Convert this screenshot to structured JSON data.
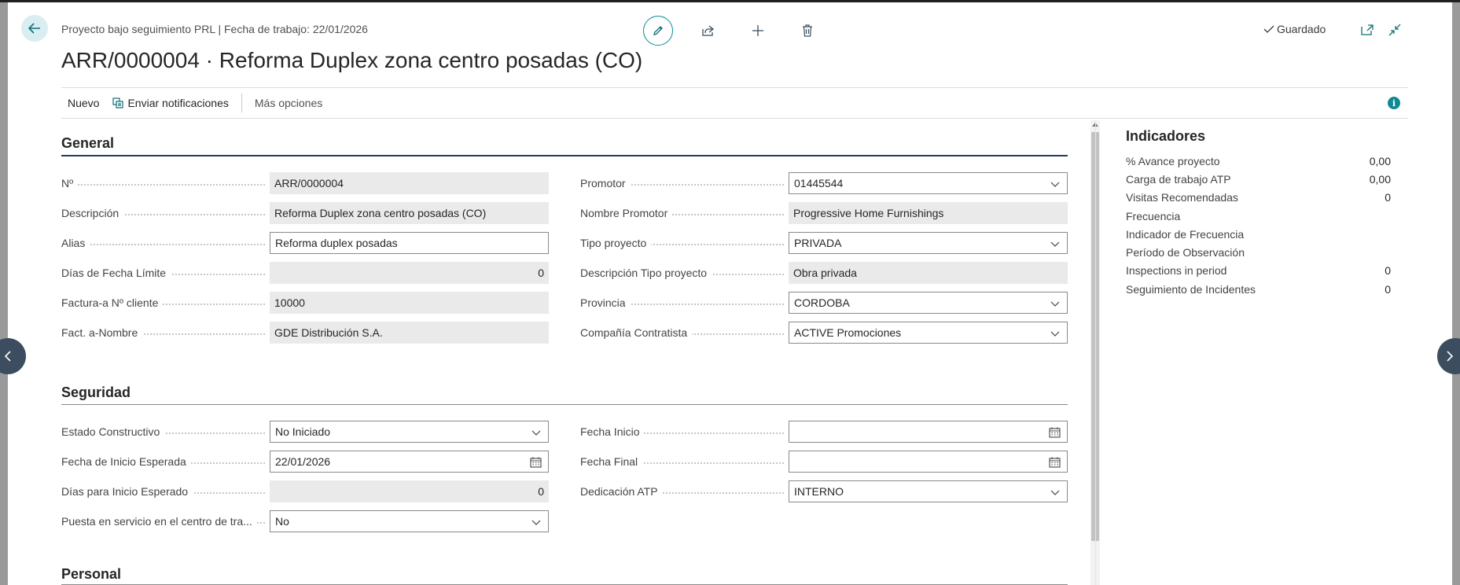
{
  "header": {
    "breadcrumb": "Proyecto bajo seguimiento PRL | Fecha de trabajo: 22/01/2026",
    "title": "ARR/0000004 · Reforma Duplex zona centro posadas (CO)",
    "status": "Guardado",
    "icons": [
      "back-arrow-icon",
      "edit-icon",
      "share-icon",
      "add-icon",
      "delete-icon",
      "check-icon",
      "open-new-window-icon",
      "collapse-icon"
    ]
  },
  "actions": {
    "new": "Nuevo",
    "notify": "Enviar notificaciones",
    "more": "Más opciones",
    "info_glyph": "i"
  },
  "general": {
    "title": "General",
    "left": [
      {
        "label": "Nº",
        "value": "ARR/0000004"
      },
      {
        "label": "Descripción",
        "value": "Reforma Duplex zona centro posadas (CO)"
      },
      {
        "label": "Alias",
        "value": "Reforma duplex posadas"
      },
      {
        "label": "Días de Fecha Límite",
        "value": "0"
      },
      {
        "label": "Factura-a Nº cliente",
        "value": "10000"
      },
      {
        "label": "Fact. a-Nombre",
        "value": "GDE Distribución S.A."
      }
    ],
    "right": [
      {
        "label": "Promotor",
        "value": "01445544"
      },
      {
        "label": "Nombre Promotor",
        "value": "Progressive Home Furnishings"
      },
      {
        "label": "Tipo proyecto",
        "value": "PRIVADA"
      },
      {
        "label": "Descripción Tipo proyecto",
        "value": "Obra privada"
      },
      {
        "label": "Provincia",
        "value": "CORDOBA"
      },
      {
        "label": "Compañía Contratista",
        "value": "ACTIVE Promociones"
      }
    ]
  },
  "seguridad": {
    "title": "Seguridad",
    "left": [
      {
        "label": "Estado Constructivo",
        "value": "No Iniciado"
      },
      {
        "label": "Fecha de Inicio Esperada",
        "value": "22/01/2026"
      },
      {
        "label": "Días para Inicio Esperado",
        "value": "0"
      },
      {
        "label": "Puesta en servicio en el centro de tra...",
        "value": "No"
      }
    ],
    "right": [
      {
        "label": "Fecha Inicio",
        "value": ""
      },
      {
        "label": "Fecha Final",
        "value": ""
      },
      {
        "label": "Dedicación ATP",
        "value": "INTERNO"
      }
    ]
  },
  "personal": {
    "title": "Personal"
  },
  "factbox": {
    "title": "Indicadores",
    "rows": [
      {
        "label": "% Avance proyecto",
        "value": "0,00"
      },
      {
        "label": "Carga de trabajo ATP",
        "value": "0,00"
      },
      {
        "label": "Visitas Recomendadas",
        "value": "0"
      },
      {
        "label": "Frecuencia",
        "value": ""
      },
      {
        "label": "Indicador de Frecuencia",
        "value": ""
      },
      {
        "label": "Período de Observación",
        "value": ""
      },
      {
        "label": "Inspections in period",
        "value": "0"
      },
      {
        "label": "Seguimiento de Incidentes",
        "value": "0"
      }
    ]
  },
  "colors": {
    "accent": "#0e8a94",
    "section_rule": "#1f3b66",
    "readonly_bg": "#eaeaea"
  }
}
